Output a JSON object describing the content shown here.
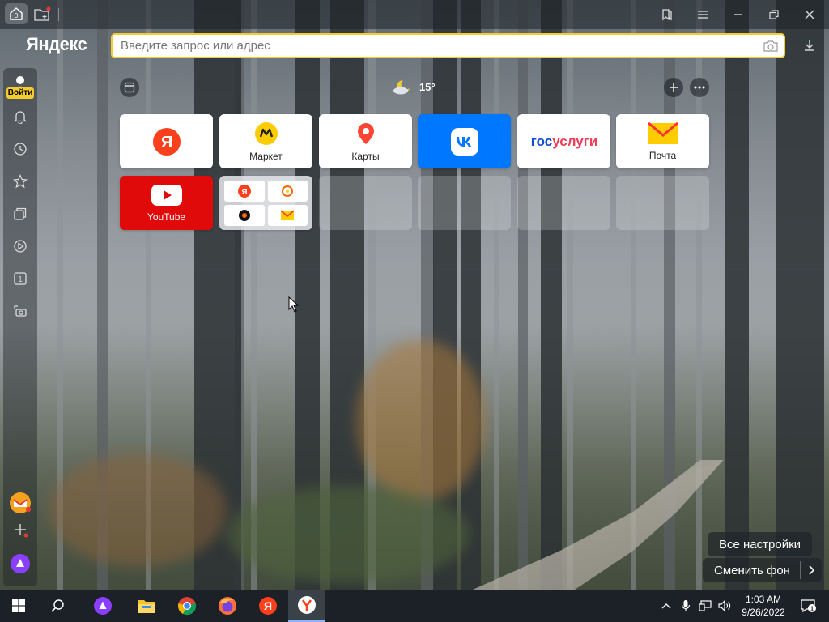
{
  "titlebar": {
    "home_tab_count": "0",
    "icons": [
      "home-tab-icon",
      "new-tab-icon",
      "bookmarks-icon",
      "menu-icon",
      "minimize-icon",
      "restore-icon",
      "close-icon"
    ]
  },
  "logo": "Яндекс",
  "omnibox": {
    "placeholder": "Введите запрос или адрес",
    "value": ""
  },
  "sidebar": {
    "login_label": "Войти",
    "tab_count": "1",
    "items": [
      "bell-icon",
      "history-icon",
      "star-icon",
      "collections-icon",
      "play-icon",
      "tabs-counter-icon",
      "screenshot-icon"
    ]
  },
  "weather": {
    "temp": "15°"
  },
  "tiles": [
    {
      "label": "",
      "icon": "yandex-icon"
    },
    {
      "label": "Маркет",
      "icon": "market-icon"
    },
    {
      "label": "Карты",
      "icon": "maps-icon"
    },
    {
      "label": "",
      "icon": "vk-icon"
    },
    {
      "label": "госуслуги",
      "icon": "gosuslugi-logo"
    },
    {
      "label": "Почта",
      "icon": "mail-icon"
    },
    {
      "label": "YouTube",
      "icon": "youtube-icon"
    }
  ],
  "bottom": {
    "settings_label": "Все настройки",
    "bg_label": "Сменить фон"
  },
  "taskbar": {
    "time": "1:03 AM",
    "date": "9/26/2022",
    "notifications": "1"
  },
  "colors": {
    "accent": "#f5cc2d",
    "vk": "#0077ff",
    "youtube": "#e10a0a",
    "yandex_red": "#fc3f1d"
  }
}
